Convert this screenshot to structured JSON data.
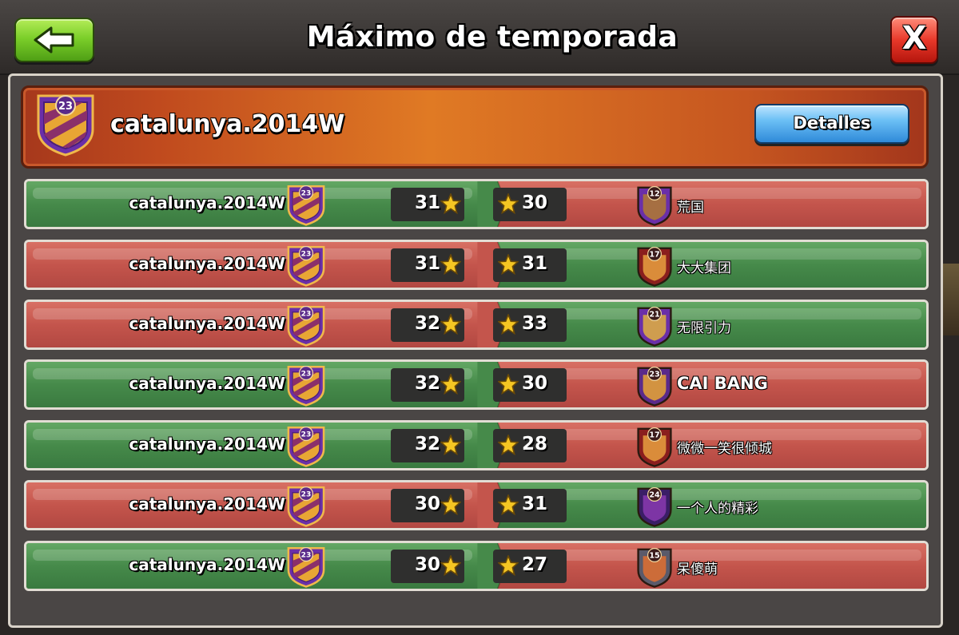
{
  "window": {
    "title": "Máximo de temporada"
  },
  "controls": {
    "back_icon": "back-arrow-icon",
    "close_label": "X"
  },
  "header": {
    "clan_name": "catalunya.2014W",
    "clan_level": "23",
    "details_label": "Detalles"
  },
  "colors": {
    "win_green": "#468a4a",
    "loss_red": "#c4554c",
    "star": "#f5c623"
  },
  "rows": [
    {
      "left_result": "win",
      "clan_name": "catalunya.2014W",
      "clan_level": "23",
      "stars_own": "31",
      "stars_opp": "30",
      "opp_level": "12",
      "opp_name": "荒国"
    },
    {
      "left_result": "loss",
      "clan_name": "catalunya.2014W",
      "clan_level": "23",
      "stars_own": "31",
      "stars_opp": "31",
      "opp_level": "17",
      "opp_name": "大大集团"
    },
    {
      "left_result": "loss",
      "clan_name": "catalunya.2014W",
      "clan_level": "23",
      "stars_own": "32",
      "stars_opp": "33",
      "opp_level": "21",
      "opp_name": "无限引力"
    },
    {
      "left_result": "win",
      "clan_name": "catalunya.2014W",
      "clan_level": "23",
      "stars_own": "32",
      "stars_opp": "30",
      "opp_level": "23",
      "opp_name": "CAI BANG"
    },
    {
      "left_result": "win",
      "clan_name": "catalunya.2014W",
      "clan_level": "23",
      "stars_own": "32",
      "stars_opp": "28",
      "opp_level": "17",
      "opp_name": "微微一笑很倾城"
    },
    {
      "left_result": "loss",
      "clan_name": "catalunya.2014W",
      "clan_level": "23",
      "stars_own": "30",
      "stars_opp": "31",
      "opp_level": "24",
      "opp_name": "一个人的精彩"
    },
    {
      "left_result": "win",
      "clan_name": "catalunya.2014W",
      "clan_level": "23",
      "stars_own": "30",
      "stars_opp": "27",
      "opp_level": "15",
      "opp_name": "呆傻萌"
    }
  ]
}
